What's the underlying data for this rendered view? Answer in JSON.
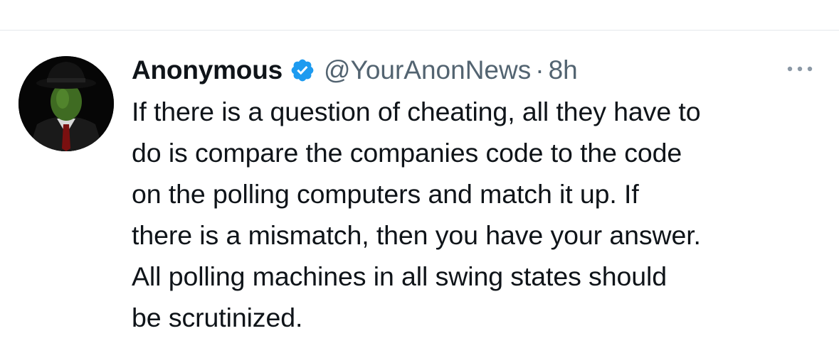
{
  "tweet": {
    "display_name": "Anonymous",
    "verified_icon": "verified-badge-icon",
    "handle": "@YourAnonNews",
    "separator": "·",
    "timestamp": "8h",
    "more_icon": "more-options-icon",
    "text": "If there is a question of cheating, all they have to\ndo is compare the companies code to the code\non the polling computers and match it up.  If\nthere is a mismatch, then you have your answer.\nAll polling machines in all swing states should\nbe scrutinized."
  },
  "colors": {
    "text_primary": "#0f1419",
    "text_secondary": "#536471",
    "verified_blue": "#1d9bf0",
    "divider": "#e4e8eb"
  }
}
